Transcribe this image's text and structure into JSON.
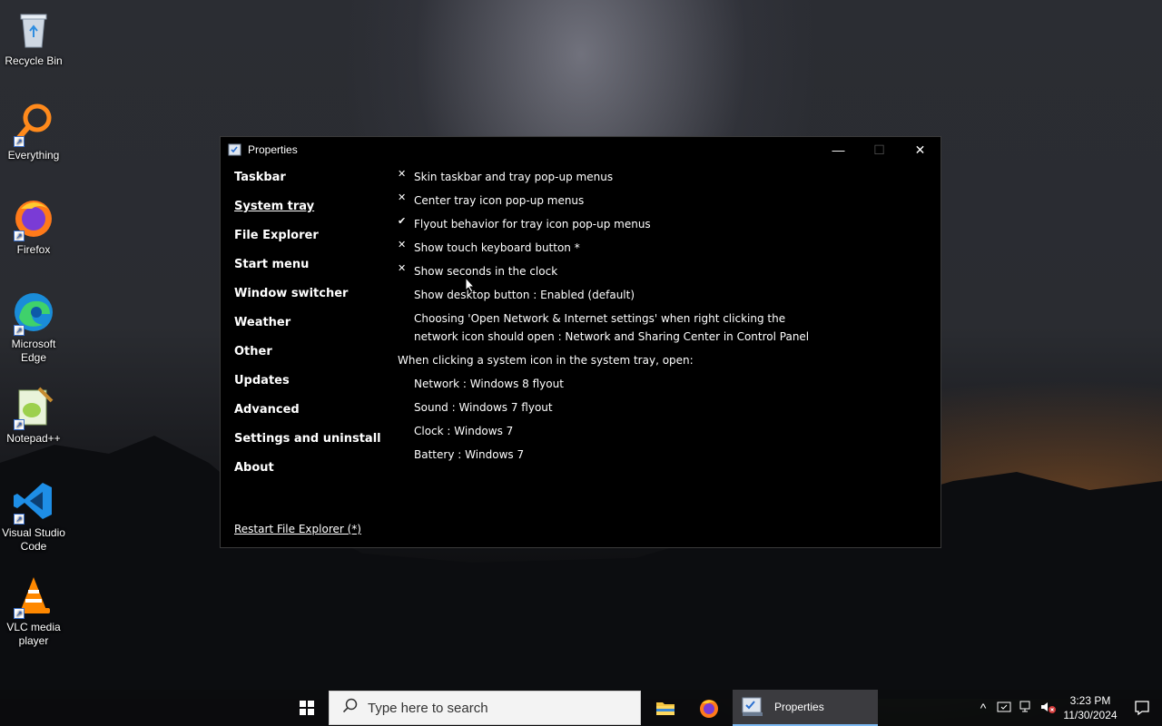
{
  "desktop": {
    "icons": [
      {
        "label": "Recycle Bin",
        "icon": "recycle-bin-icon"
      },
      {
        "label": "Everything",
        "icon": "everything-icon"
      },
      {
        "label": "Firefox",
        "icon": "firefox-icon"
      },
      {
        "label": "Microsoft Edge",
        "icon": "edge-icon"
      },
      {
        "label": "Notepad++",
        "icon": "notepadpp-icon"
      },
      {
        "label": "Visual Studio Code",
        "icon": "vscode-icon"
      },
      {
        "label": "VLC media player",
        "icon": "vlc-icon"
      }
    ]
  },
  "window": {
    "title": "Properties",
    "minimize": "—",
    "maximize": "☐",
    "close": "✕",
    "nav": [
      {
        "label": "Taskbar",
        "active": false
      },
      {
        "label": "System tray",
        "active": true
      },
      {
        "label": "File Explorer",
        "active": false
      },
      {
        "label": "Start menu",
        "active": false
      },
      {
        "label": "Window switcher",
        "active": false
      },
      {
        "label": "Weather",
        "active": false
      },
      {
        "label": "Other",
        "active": false
      },
      {
        "label": "Updates",
        "active": false
      },
      {
        "label": "Advanced",
        "active": false
      },
      {
        "label": "Settings and uninstall",
        "active": false
      },
      {
        "label": "About",
        "active": false
      }
    ],
    "restart_link": "Restart File Explorer (*)",
    "options": [
      {
        "mark": "✕",
        "label": "Skin taskbar and tray pop-up menus"
      },
      {
        "mark": "✕",
        "label": "Center tray icon pop-up menus"
      },
      {
        "mark": "✔",
        "label": "Flyout behavior for tray icon pop-up menus"
      },
      {
        "mark": "✕",
        "label": "Show touch keyboard button *"
      },
      {
        "mark": "✕",
        "label": "Show seconds in the clock"
      },
      {
        "mark": "",
        "label": "Show desktop button : Enabled (default)"
      }
    ],
    "network_option": {
      "line1": "Choosing 'Open Network & Internet settings' when right clicking the",
      "line2": "network icon should open : Network and Sharing Center in Control Panel"
    },
    "section_heading": "When clicking a system icon in the system tray, open:",
    "sub_options": [
      "Network : Windows 8 flyout",
      "Sound : Windows 7 flyout",
      "Clock : Windows 7",
      "Battery : Windows 7"
    ]
  },
  "taskbar": {
    "search_placeholder": "Type here to search",
    "active_app_label": "Properties",
    "time": "3:23 PM",
    "date": "11/30/2024"
  }
}
